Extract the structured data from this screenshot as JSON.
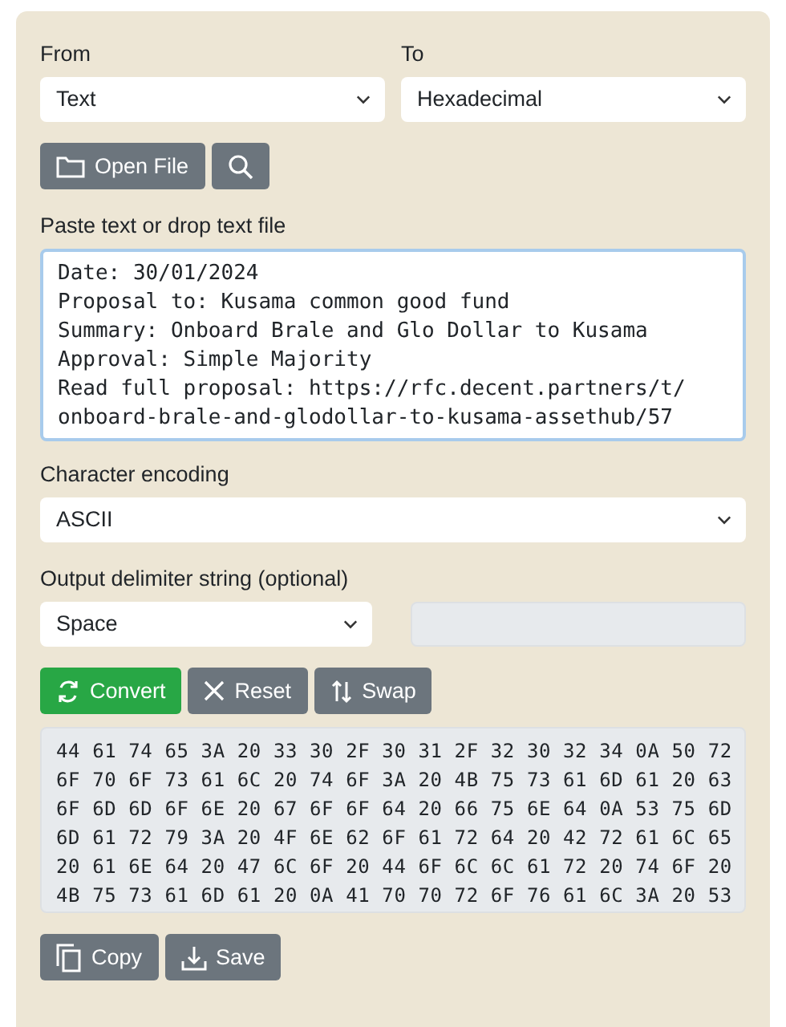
{
  "from": {
    "label": "From",
    "value": "Text"
  },
  "to": {
    "label": "To",
    "value": "Hexadecimal"
  },
  "file_buttons": [
    {
      "kind": "folder",
      "label": "Open File"
    },
    {
      "kind": "search"
    }
  ],
  "input": {
    "label": "Paste text or drop text file",
    "focused": true,
    "lines": [
      "Date: 30/01/2024",
      "Proposal to: Kusama common good fund",
      "Summary: Onboard Brale and Glo Dollar to Kusama",
      "Approval: Simple Majority",
      "Read full proposal: https://rfc.decent.partners/t/",
      "onboard-brale-and-glodollar-to-kusama-assethub/57"
    ]
  },
  "encoding": {
    "label": "Character encoding",
    "value": "ASCII"
  },
  "delimiter": {
    "label": "Output delimiter string (optional)",
    "value": "Space",
    "custom_disabled": true
  },
  "action_buttons": [
    {
      "kind": "convert",
      "label": "Convert"
    },
    {
      "kind": "reset",
      "label": "Reset"
    },
    {
      "kind": "swap",
      "label": "Swap"
    }
  ],
  "output": {
    "lines": [
      "44 61 74 65 3A 20 33 30 2F 30 31 2F 32 30 32 34 0A 50 72",
      "6F 70 6F 73 61 6C 20 74 6F 3A 20 4B 75 73 61 6D 61 20 63",
      "6F 6D 6D 6F 6E 20 67 6F 6F 64 20 66 75 6E 64 0A 53 75 6D",
      "6D 61 72 79 3A 20 4F 6E 62 6F 61 72 64 20 42 72 61 6C 65",
      "20 61 6E 64 20 47 6C 6F 20 44 6F 6C 6C 61 72 20 74 6F 20",
      "4B 75 73 61 6D 61 20 0A 41 70 70 72 6F 76 61 6C 3A 20 53"
    ]
  },
  "output_buttons": [
    {
      "kind": "copy",
      "label": "Copy"
    },
    {
      "kind": "save",
      "label": "Save"
    }
  ]
}
